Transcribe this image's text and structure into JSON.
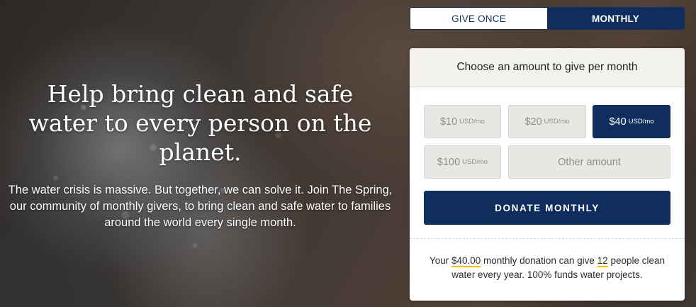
{
  "hero": {
    "title": "Help bring clean and safe water to every person on the planet.",
    "body": "The water crisis is massive. But together, we can solve it. Join The Spring, our community of monthly givers, to bring clean and safe water to families around the world every single month."
  },
  "frequency_toggle": {
    "once_label": "GIVE ONCE",
    "monthly_label": "MONTHLY",
    "selected": "MONTHLY"
  },
  "donation_card": {
    "header": "Choose an amount to give per month",
    "amounts": [
      {
        "amount": "$10",
        "unit": "USD/mo",
        "selected": false
      },
      {
        "amount": "$20",
        "unit": "USD/mo",
        "selected": false
      },
      {
        "amount": "$40",
        "unit": "USD/mo",
        "selected": true
      },
      {
        "amount": "$100",
        "unit": "USD/mo",
        "selected": false
      }
    ],
    "other_amount_label": "Other amount",
    "donate_label": "DONATE MONTHLY",
    "impact": {
      "prefix": "Your",
      "amount": "$40.00",
      "middle": "monthly donation can give",
      "people": "12",
      "suffix": "people clean water every year. 100% funds water projects."
    }
  },
  "colors": {
    "navy": "#0f2e5d",
    "highlight_underline": "#f2c000",
    "card_header_bg": "#f3f2ee",
    "amount_button_bg": "#e8e7e3"
  }
}
